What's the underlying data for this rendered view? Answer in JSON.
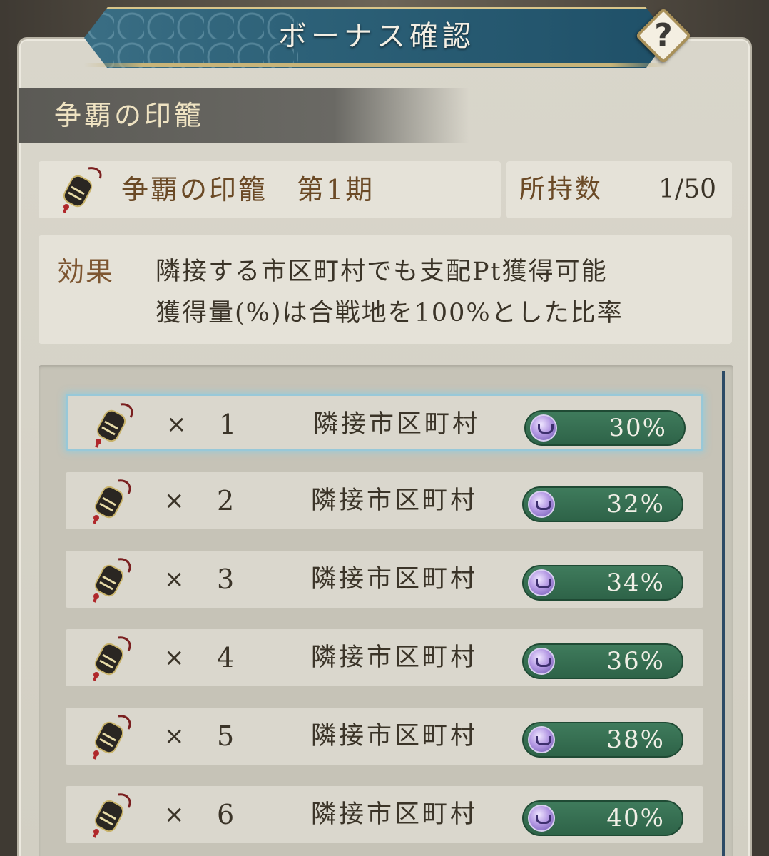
{
  "title": "ボーナス確認",
  "help_label": "?",
  "section_header": "争覇の印籠",
  "item": {
    "name": "争覇の印籠　第1期",
    "owned_label": "所持数",
    "owned_value": "1/50"
  },
  "effect": {
    "label": "効果",
    "line1": "隣接する市区町村でも支配Pt獲得可能",
    "line2": "獲得量(%)は合戦地を100%とした比率"
  },
  "rows": [
    {
      "times": "×",
      "count": "1",
      "target": "隣接市区町村",
      "percent": "30%",
      "selected": true
    },
    {
      "times": "×",
      "count": "2",
      "target": "隣接市区町村",
      "percent": "32%",
      "selected": false
    },
    {
      "times": "×",
      "count": "3",
      "target": "隣接市区町村",
      "percent": "34%",
      "selected": false
    },
    {
      "times": "×",
      "count": "4",
      "target": "隣接市区町村",
      "percent": "36%",
      "selected": false
    },
    {
      "times": "×",
      "count": "5",
      "target": "隣接市区町村",
      "percent": "38%",
      "selected": false
    },
    {
      "times": "×",
      "count": "6",
      "target": "隣接市区町村",
      "percent": "40%",
      "selected": false
    }
  ],
  "colors": {
    "banner": "#2c6077",
    "pill": "#2e6348",
    "selected_glow": "#98c8d8"
  }
}
